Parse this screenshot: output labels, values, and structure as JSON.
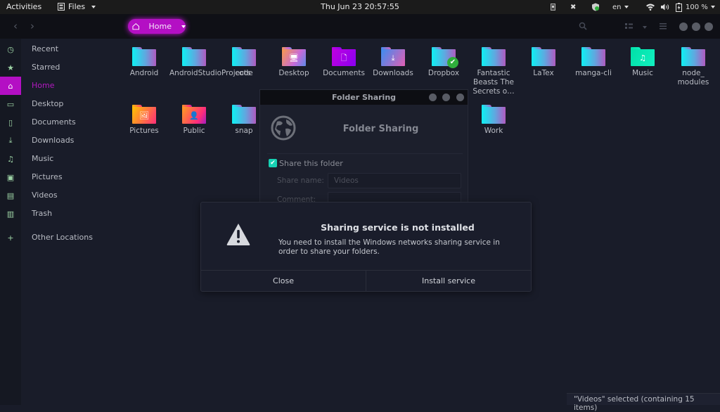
{
  "topbar": {
    "activities": "Activities",
    "app_menu": "Files",
    "clock": "Thu Jun 23  20:57:55",
    "language": "en",
    "battery": "100 %"
  },
  "headerbar": {
    "path_label": "Home"
  },
  "sidebar": {
    "items": [
      {
        "label": "Recent",
        "icon": "clock-icon"
      },
      {
        "label": "Starred",
        "icon": "star-icon"
      },
      {
        "label": "Home",
        "icon": "home-icon",
        "active": true
      },
      {
        "label": "Desktop",
        "icon": "desktop-icon"
      },
      {
        "label": "Documents",
        "icon": "document-icon"
      },
      {
        "label": "Downloads",
        "icon": "download-icon"
      },
      {
        "label": "Music",
        "icon": "music-icon"
      },
      {
        "label": "Pictures",
        "icon": "picture-icon"
      },
      {
        "label": "Videos",
        "icon": "video-icon"
      },
      {
        "label": "Trash",
        "icon": "trash-icon"
      },
      {
        "label": "Other Locations",
        "icon": "plus-icon"
      }
    ]
  },
  "folders": [
    {
      "name": "Android"
    },
    {
      "name": "AndroidStudioProjects"
    },
    {
      "name": "code"
    },
    {
      "name": "Desktop"
    },
    {
      "name": "Documents"
    },
    {
      "name": "Downloads"
    },
    {
      "name": "Dropbox"
    },
    {
      "name": "Fantastic Beasts The Secrets o…"
    },
    {
      "name": "LaTex"
    },
    {
      "name": "manga-cli"
    },
    {
      "name": "Music"
    },
    {
      "name": "node_ modules"
    },
    {
      "name": "Pictures"
    },
    {
      "name": "Public"
    },
    {
      "name": "snap"
    },
    {
      "name": "Work"
    }
  ],
  "status": "\"Videos\" selected  (containing 15 items)",
  "folder_sharing": {
    "window_title": "Folder Sharing",
    "heading": "Folder Sharing",
    "share_checkbox_label": "Share this folder",
    "share_checked": true,
    "share_name_label": "Share name:",
    "share_name_value": "Videos",
    "comment_label": "Comment:",
    "comment_value": ""
  },
  "alert": {
    "title": "Sharing service is not installed",
    "message": "You need to install the Windows networks sharing service in order to share your folders.",
    "close_label": "Close",
    "install_label": "Install service"
  },
  "colors": {
    "accent": "#b40fc4",
    "check": "#17d1b3"
  }
}
